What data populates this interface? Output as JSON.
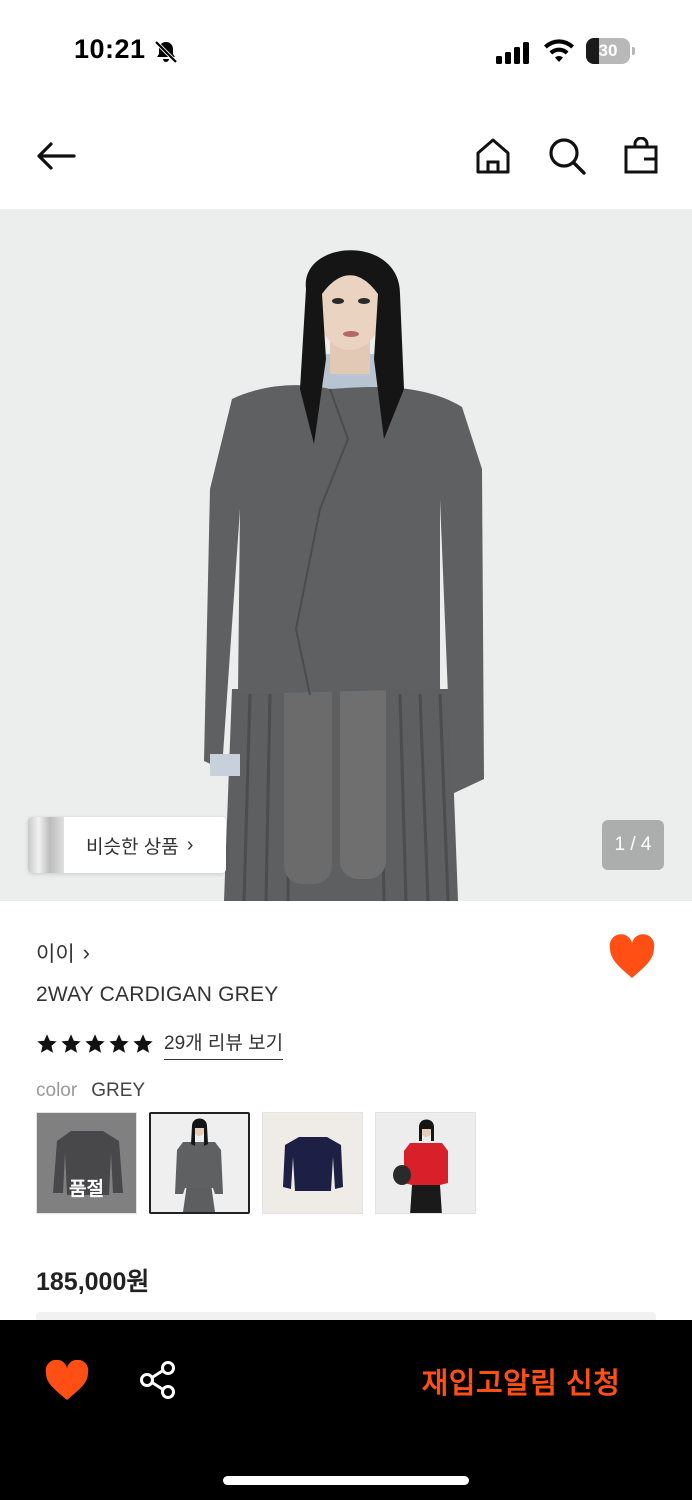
{
  "status_bar": {
    "time": "10:21",
    "battery_level": "30",
    "battery_fraction": 0.3,
    "icons": [
      "bell-muted-icon",
      "cellular-signal-icon",
      "wifi-icon",
      "battery-icon"
    ]
  },
  "header": {
    "icons": [
      "back-arrow-icon",
      "home-icon",
      "search-icon",
      "shopping-bag-icon"
    ]
  },
  "hero": {
    "similar_label": "비슷한 상품",
    "similar_chevron": "›",
    "page_indicator": "1 / 4"
  },
  "product": {
    "brand": "이이",
    "brand_chevron": "›",
    "name": "2WAY CARDIGAN GREY",
    "rating": 5,
    "rating_max": 5,
    "review_link": "29개 리뷰 보기",
    "color_key": "color",
    "color_value": "GREY",
    "price": "185,000원",
    "favorite": true
  },
  "swatches": [
    {
      "name": "dark-grey",
      "soldout_label": "품절",
      "soldout": true,
      "selected": false
    },
    {
      "name": "grey",
      "selected": true
    },
    {
      "name": "navy",
      "selected": false
    },
    {
      "name": "red",
      "selected": false
    }
  ],
  "bottom_bar": {
    "restock_label": "재입고알림 신청",
    "icons": [
      "heart-icon",
      "share-icon"
    ]
  },
  "colors": {
    "accent": "#ff4f14",
    "hero_bg": "#eceeee",
    "bottom_bar_bg": "#000000"
  }
}
